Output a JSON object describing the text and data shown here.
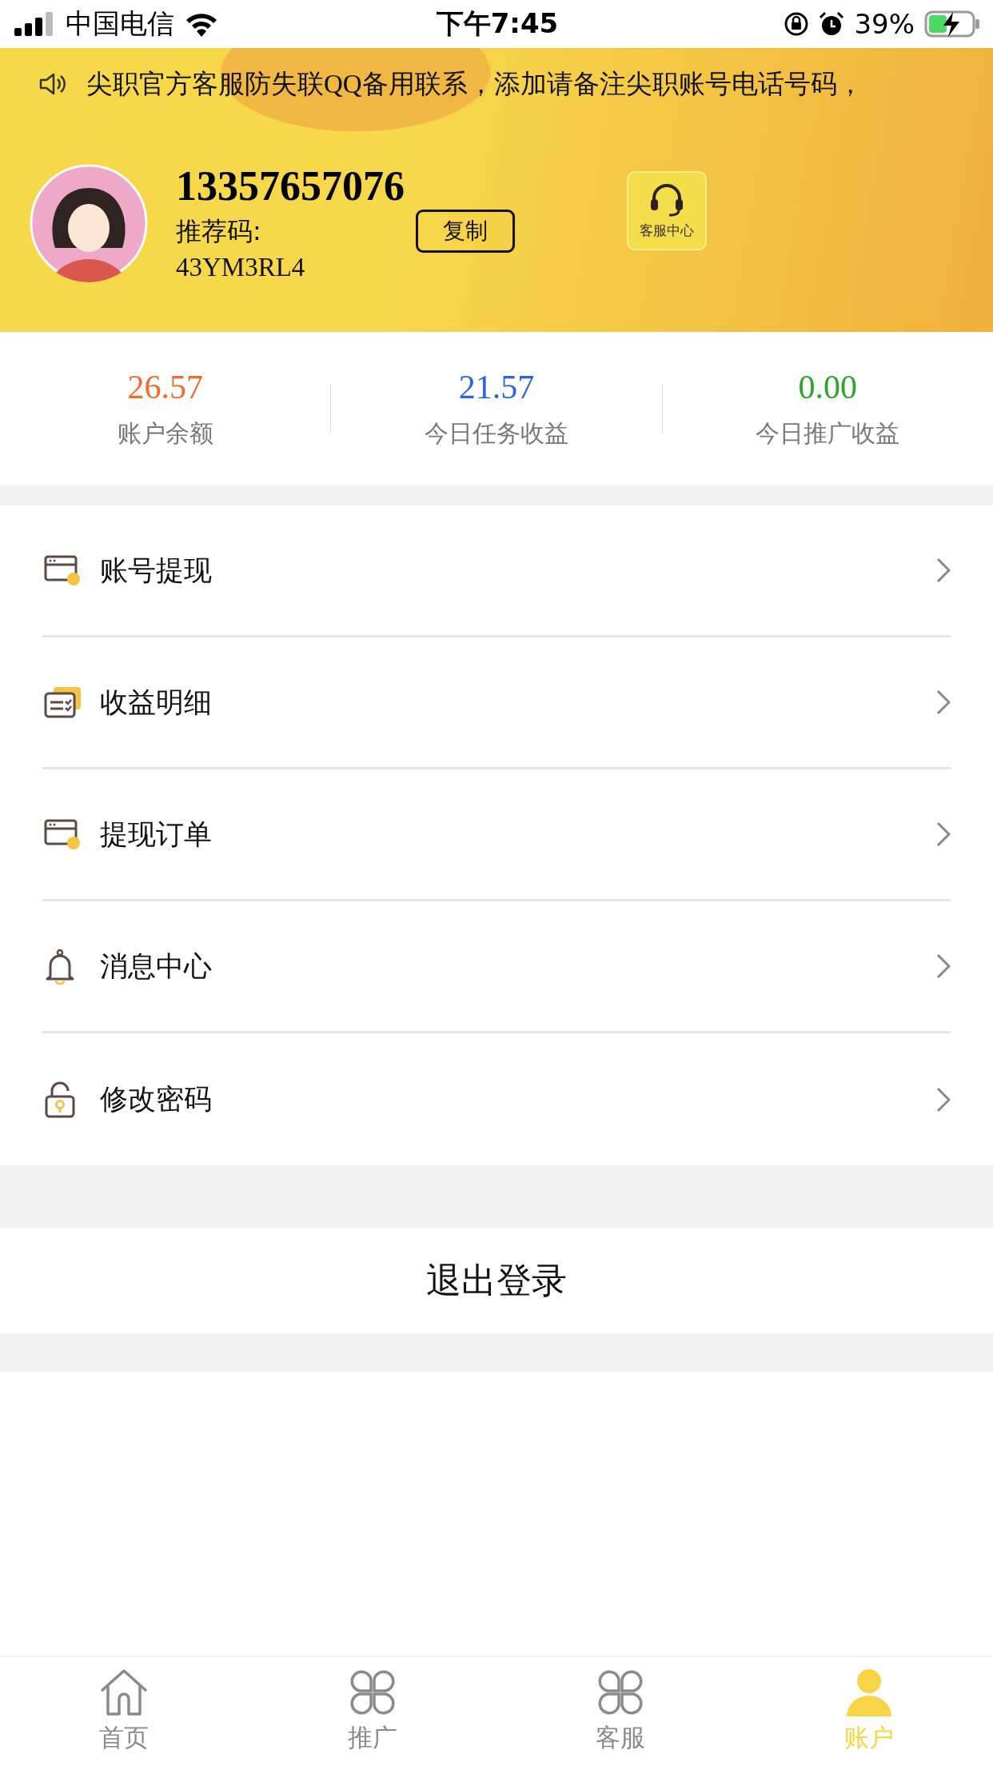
{
  "status_bar": {
    "carrier": "中国电信",
    "time": "下午7:45",
    "battery": "39%"
  },
  "notice": {
    "text": "尖职官方客服防失联QQ备用联系，添加请备注尖职账号电话号码，"
  },
  "profile": {
    "phone": "13357657076",
    "referral_label": "推荐码:",
    "referral_code": "43YM3RL4",
    "copy_button": "复制",
    "service_button": "客服中心"
  },
  "stats": [
    {
      "value": "26.57",
      "label": "账户余额",
      "color": "#f26b2b"
    },
    {
      "value": "21.57",
      "label": "今日任务收益",
      "color": "#2a64e0"
    },
    {
      "value": "0.00",
      "label": "今日推广收益",
      "color": "#2ea52a"
    }
  ],
  "menu": [
    {
      "label": "账号提现",
      "kind": "wallet"
    },
    {
      "label": "收益明细",
      "kind": "ledger"
    },
    {
      "label": "提现订单",
      "kind": "wallet"
    },
    {
      "label": "消息中心",
      "kind": "bell"
    },
    {
      "label": "修改密码",
      "kind": "lock"
    }
  ],
  "logout": "退出登录",
  "tabs": [
    {
      "label": "首页",
      "kind": "home",
      "selected": false
    },
    {
      "label": "推广",
      "kind": "clover",
      "selected": false
    },
    {
      "label": "客服",
      "kind": "clover",
      "selected": false
    },
    {
      "label": "账户",
      "kind": "person",
      "selected": true
    }
  ]
}
